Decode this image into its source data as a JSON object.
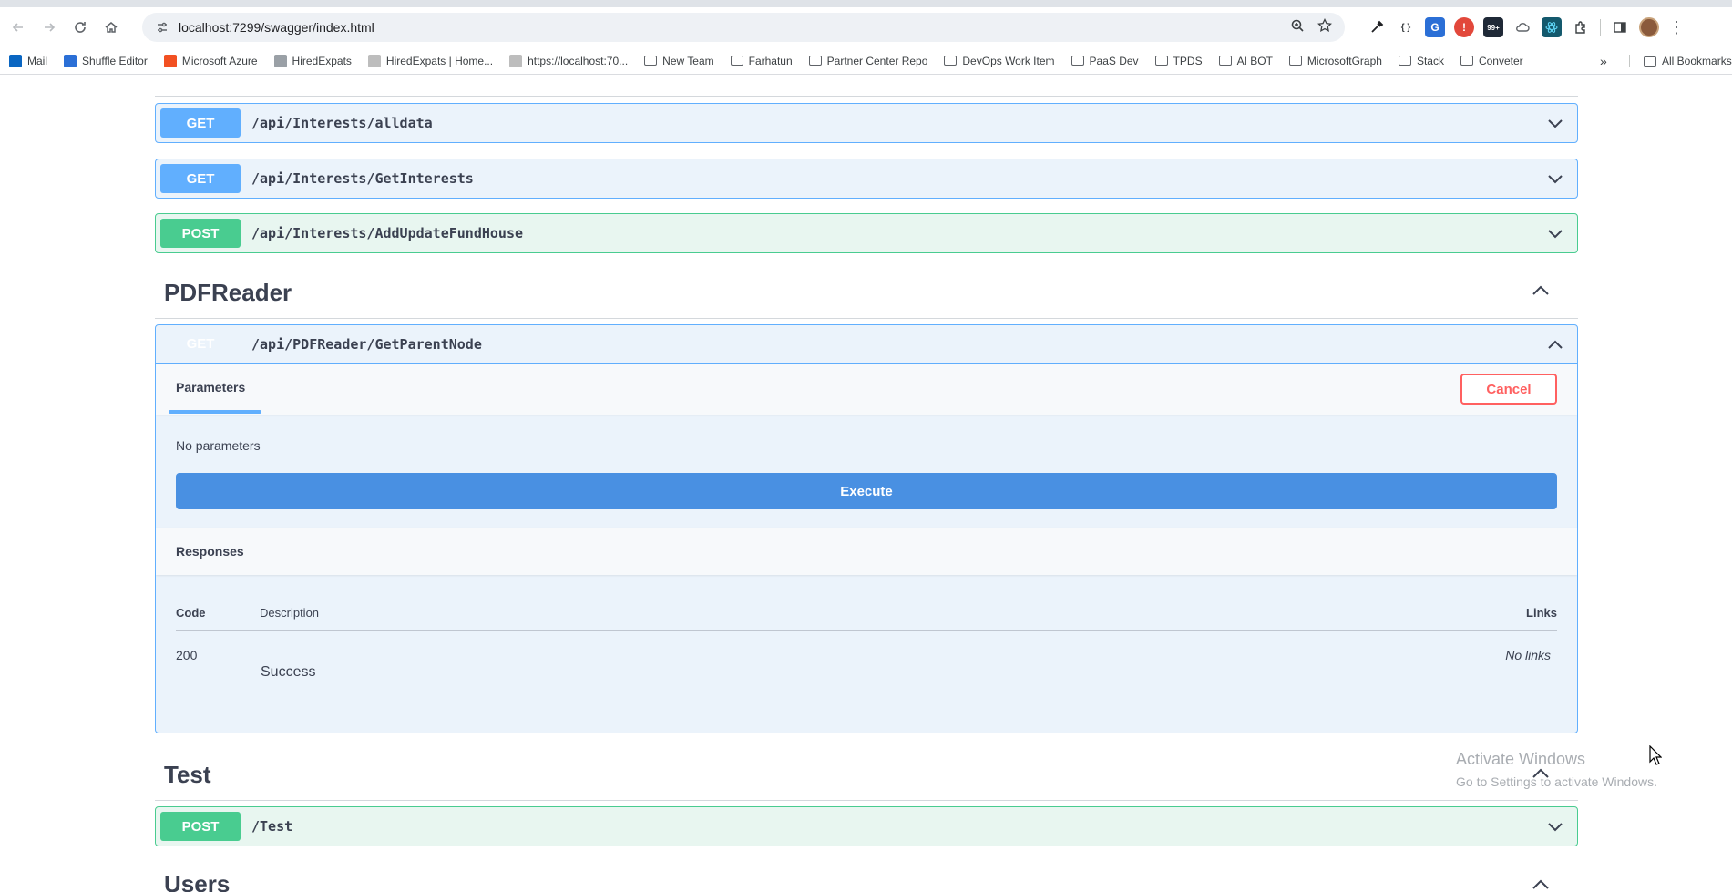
{
  "browser": {
    "url": "localhost:7299/swagger/index.html",
    "extensions": {
      "badge_label": "99+"
    },
    "bookmarks": [
      {
        "label": "Mail",
        "icon": "outlook-icon",
        "color": "#0a66c2"
      },
      {
        "label": "Shuffle Editor",
        "icon": "shuffle-icon",
        "color": "#2b6fd6"
      },
      {
        "label": "Microsoft Azure",
        "icon": "microsoft-icon",
        "color": "#f25022"
      },
      {
        "label": "HiredExpats",
        "icon": "doc-icon",
        "color": "#9aa0a6"
      },
      {
        "label": "HiredExpats | Home...",
        "icon": "page-icon",
        "color": "#bdbdbd"
      },
      {
        "label": "https://localhost:70...",
        "icon": "page-icon",
        "color": "#bdbdbd"
      },
      {
        "label": "New Team",
        "icon": "folder-icon"
      },
      {
        "label": "Farhatun",
        "icon": "folder-icon"
      },
      {
        "label": "Partner Center Repo",
        "icon": "folder-icon"
      },
      {
        "label": "DevOps Work Item",
        "icon": "folder-icon"
      },
      {
        "label": "PaaS Dev",
        "icon": "folder-icon"
      },
      {
        "label": "TPDS",
        "icon": "folder-icon"
      },
      {
        "label": "AI BOT",
        "icon": "folder-icon"
      },
      {
        "label": "MicrosoftGraph",
        "icon": "folder-icon"
      },
      {
        "label": "Stack",
        "icon": "folder-icon"
      },
      {
        "label": "Conveter",
        "icon": "folder-icon"
      }
    ],
    "more_label": "»",
    "all_bookmarks_label": "All Bookmarks"
  },
  "endpoints_top": [
    {
      "method": "GET",
      "path": "/api/Interests/alldata"
    },
    {
      "method": "GET",
      "path": "/api/Interests/GetInterests"
    },
    {
      "method": "POST",
      "path": "/api/Interests/AddUpdateFundHouse"
    }
  ],
  "pdfreader": {
    "title": "PDFReader",
    "endpoint": {
      "method": "GET",
      "path": "/api/PDFReader/GetParentNode",
      "parameters_tab": "Parameters",
      "cancel_label": "Cancel",
      "no_parameters": "No parameters",
      "execute_label": "Execute",
      "responses_title": "Responses",
      "columns": {
        "code": "Code",
        "description": "Description",
        "links": "Links"
      },
      "rows": [
        {
          "code": "200",
          "description": "Success",
          "links": "No links"
        }
      ]
    }
  },
  "test": {
    "title": "Test",
    "endpoint": {
      "method": "POST",
      "path": "/Test"
    }
  },
  "users": {
    "title": "Users"
  },
  "watermark": {
    "line1": "Activate Windows",
    "line2": "Go to Settings to activate Windows."
  },
  "colors": {
    "get": "#61affe",
    "post": "#49cc90",
    "execute": "#4990e2",
    "cancel": "#ff6060"
  }
}
